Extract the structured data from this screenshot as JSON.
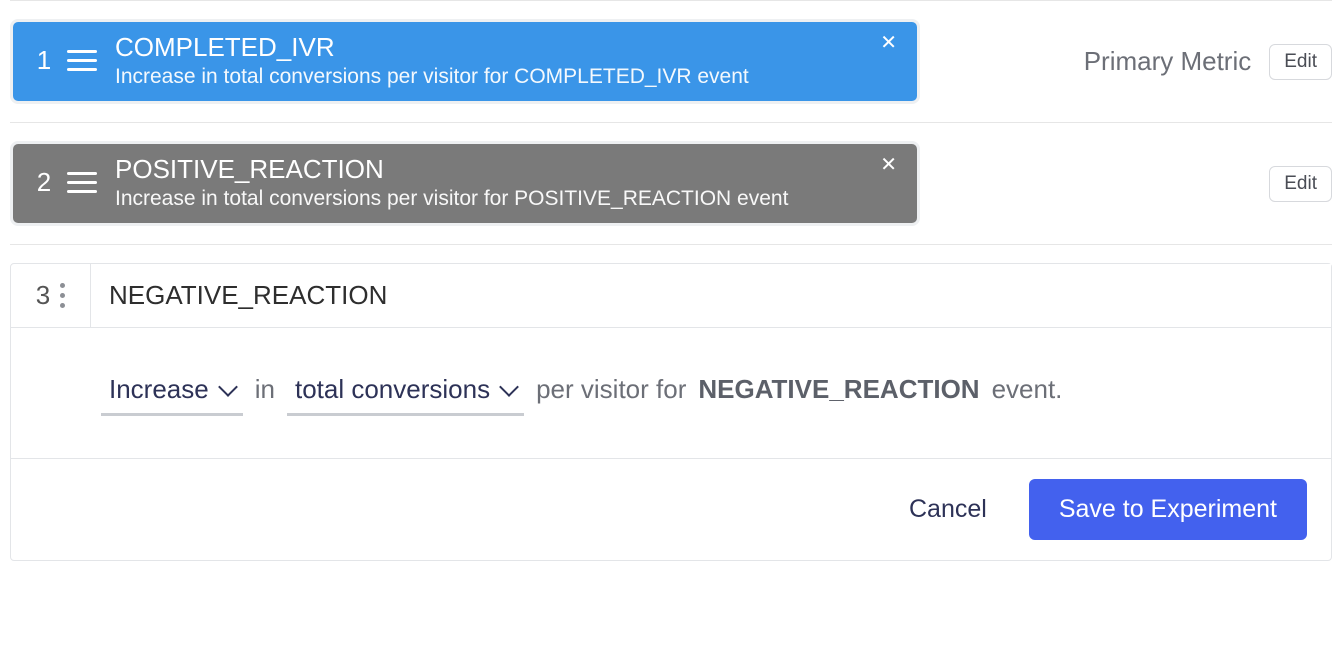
{
  "metrics": [
    {
      "num": "1",
      "title": "COMPLETED_IVR",
      "sub": "Increase in total conversions per visitor for COMPLETED_IVR event",
      "primary_label": "Primary Metric",
      "edit": "Edit"
    },
    {
      "num": "2",
      "title": "POSITIVE_REACTION",
      "sub": "Increase in total conversions per visitor for POSITIVE_REACTION event",
      "edit": "Edit"
    }
  ],
  "editor": {
    "num": "3",
    "name": "NEGATIVE_REACTION",
    "direction": "Increase",
    "measure": "total conversions",
    "text_in": "in",
    "text_per": "per visitor for",
    "event_name": "NEGATIVE_REACTION",
    "text_event": "event.",
    "cancel": "Cancel",
    "save": "Save to Experiment"
  }
}
